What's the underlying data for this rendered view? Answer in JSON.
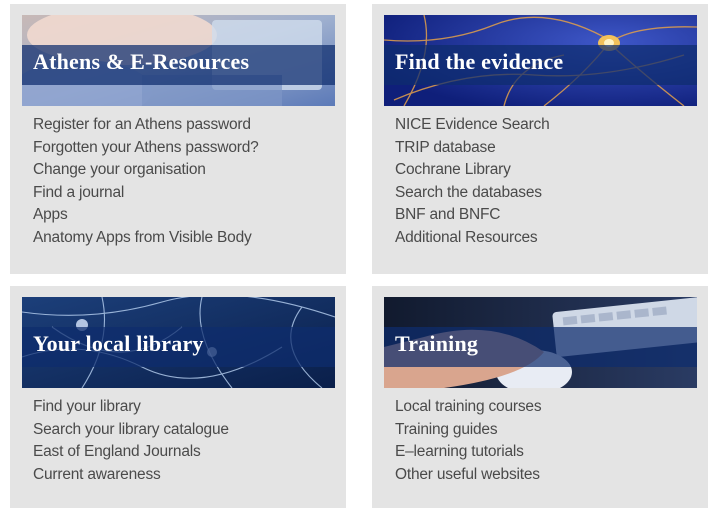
{
  "colors": {
    "card_bg": "#e4e4e4",
    "title_bar": "#0e2c6e",
    "link_text": "#4a4a4a"
  },
  "cards": [
    {
      "title": "Athens & E-Resources",
      "image": "person-at-laptop-photo",
      "links": [
        "Register for an Athens password",
        "Forgotten your Athens password?",
        "Change your organisation",
        "Find a journal",
        "Apps",
        "Anatomy Apps from Visible Body"
      ]
    },
    {
      "title": "Find the evidence",
      "image": "neuron-network-photo",
      "links": [
        "NICE Evidence Search",
        "TRIP database",
        "Cochrane Library",
        "Search the databases",
        "BNF and BNFC",
        "Additional Resources"
      ]
    },
    {
      "title": "Your local library",
      "image": "neural-cells-photo",
      "links": [
        "Find your library",
        "Search your library catalogue",
        "East of England Journals",
        "Current awareness"
      ]
    },
    {
      "title": "Training",
      "image": "hand-on-mouse-keyboard-photo",
      "links": [
        "Local training courses",
        "Training guides",
        "E–learning tutorials",
        "Other useful websites"
      ]
    }
  ]
}
